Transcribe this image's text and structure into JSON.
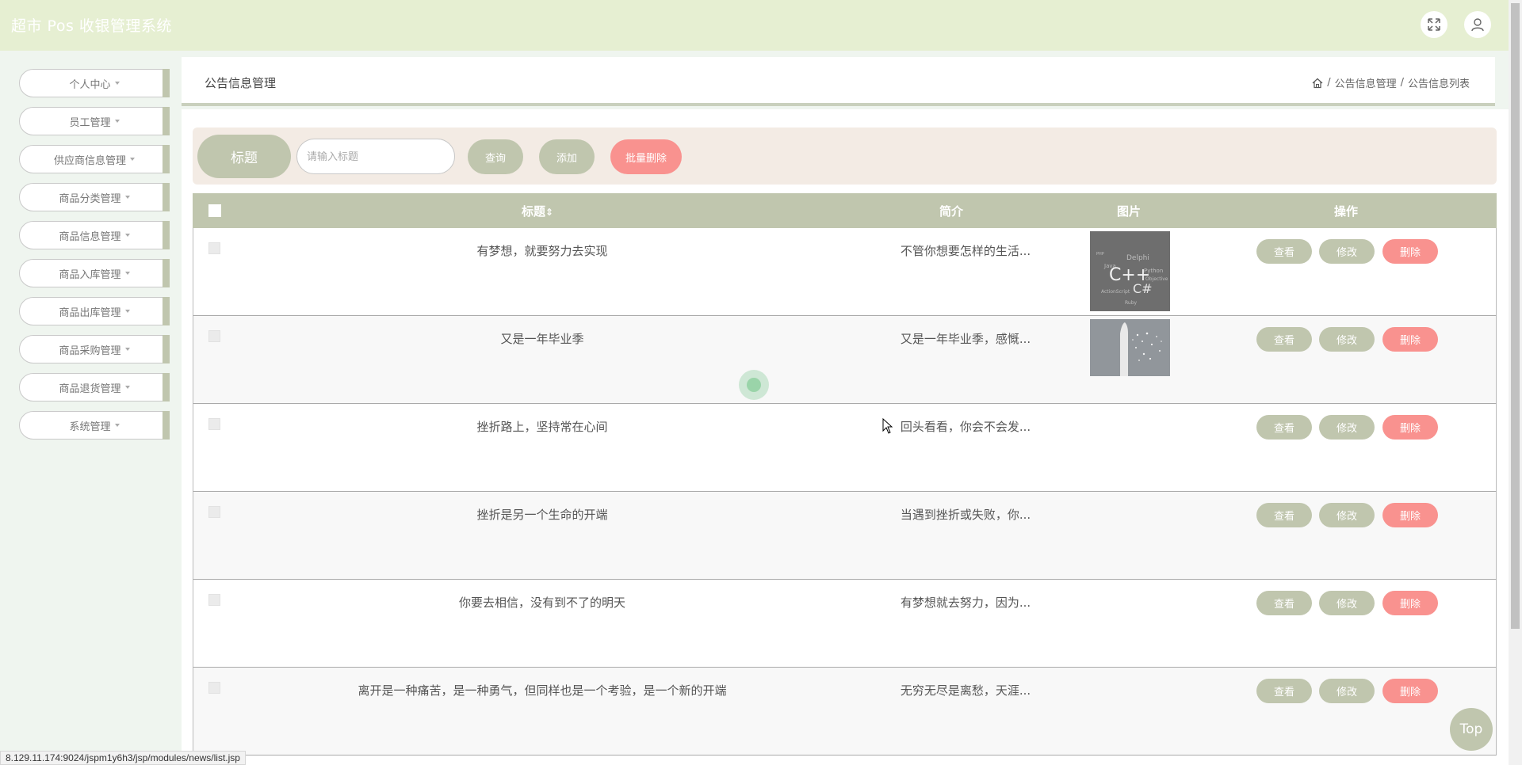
{
  "header": {
    "app_title": "超市 Pos 收银管理系统",
    "fullscreen_icon": "expand-icon",
    "user_icon": "user-icon"
  },
  "sidebar": {
    "items": [
      {
        "label": "个人中心"
      },
      {
        "label": "员工管理"
      },
      {
        "label": "供应商信息管理"
      },
      {
        "label": "商品分类管理"
      },
      {
        "label": "商品信息管理"
      },
      {
        "label": "商品入库管理"
      },
      {
        "label": "商品出库管理"
      },
      {
        "label": "商品采购管理"
      },
      {
        "label": "商品退货管理"
      },
      {
        "label": "系统管理"
      }
    ]
  },
  "page": {
    "title": "公告信息管理",
    "breadcrumb": [
      "公告信息管理",
      "公告信息列表"
    ]
  },
  "search": {
    "label": "标题",
    "placeholder": "请输入标题",
    "query_label": "查询",
    "add_label": "添加",
    "batch_delete_label": "批量删除"
  },
  "table": {
    "columns": {
      "title": "标题",
      "sort_glyph": "⇕",
      "intro": "简介",
      "image": "图片",
      "actions": "操作"
    },
    "rows": [
      {
        "title": "有梦想，就要努力去实现",
        "intro": "不管你想要怎样的生活...",
        "image": "cpp-wordcloud"
      },
      {
        "title": "又是一年毕业季",
        "intro": "又是一年毕业季，感慨...",
        "image": "rocket-launch"
      },
      {
        "title": "挫折路上，坚持常在心间",
        "intro": "回头看看，你会不会发...",
        "image": ""
      },
      {
        "title": "挫折是另一个生命的开端",
        "intro": "当遇到挫折或失败，你...",
        "image": ""
      },
      {
        "title": "你要去相信，没有到不了的明天",
        "intro": "有梦想就去努力，因为...",
        "image": ""
      },
      {
        "title": "离开是一种痛苦，是一种勇气，但同样也是一个考验，是一个新的开端",
        "intro": "无穷无尽是离愁，天涯...",
        "image": ""
      }
    ],
    "actions": {
      "view": "查看",
      "edit": "修改",
      "delete": "删除"
    }
  },
  "misc": {
    "top_label": "Top",
    "status_url": "8.129.11.174:9024/jspm1y6h3/jsp/modules/news/list.jsp"
  },
  "colors": {
    "header_bg": "#e6efd2",
    "accent": "#c0c6ae",
    "danger": "#f9928f",
    "sidebar_bg": "#eff5ef",
    "search_bg": "#f3ebe4"
  }
}
